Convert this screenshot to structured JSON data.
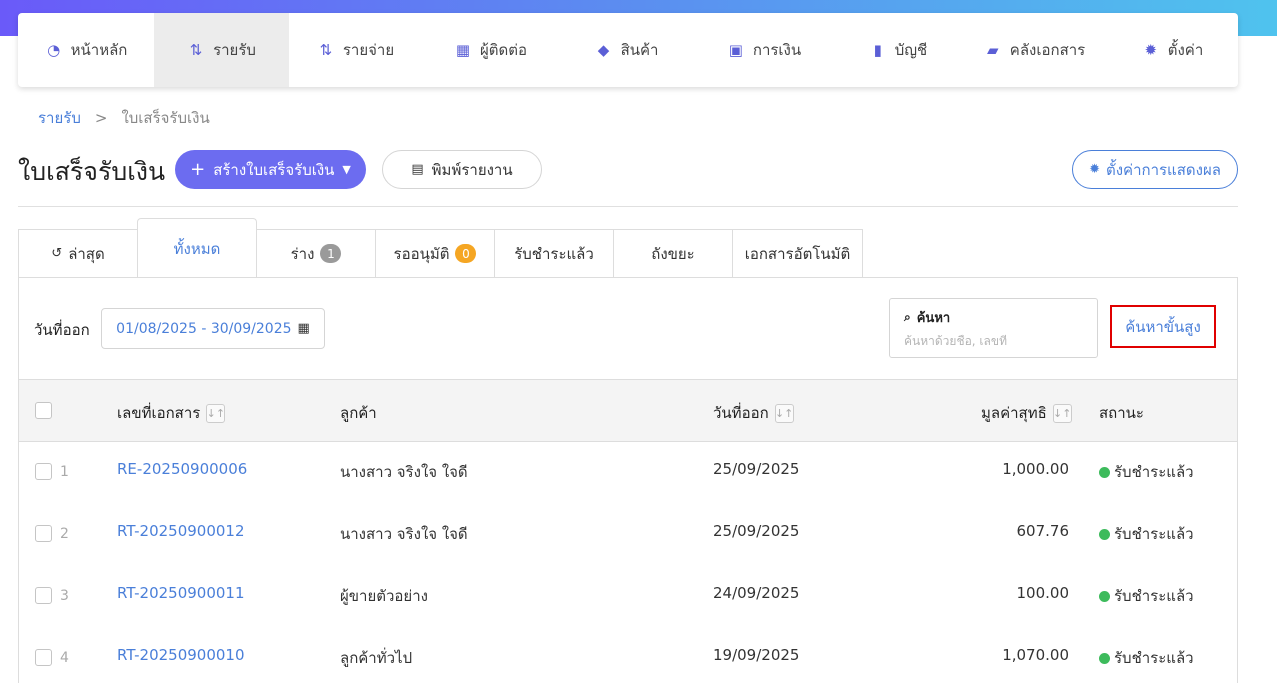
{
  "nav": {
    "items": [
      {
        "label": "หน้าหลัก",
        "icon": "dashboard-icon",
        "active": false
      },
      {
        "label": "รายรับ",
        "icon": "income-icon",
        "active": true
      },
      {
        "label": "รายจ่าย",
        "icon": "expense-icon",
        "active": false
      },
      {
        "label": "ผู้ติดต่อ",
        "icon": "contacts-icon",
        "active": false
      },
      {
        "label": "สินค้า",
        "icon": "box-icon",
        "active": false
      },
      {
        "label": "การเงิน",
        "icon": "money-icon",
        "active": false
      },
      {
        "label": "บัญชี",
        "icon": "ledger-icon",
        "active": false
      },
      {
        "label": "คลังเอกสาร",
        "icon": "folder-icon",
        "active": false
      },
      {
        "label": "ตั้งค่า",
        "icon": "gear-icon",
        "active": false
      }
    ]
  },
  "breadcrumb": {
    "parent": "รายรับ",
    "separator": ">",
    "current": "ใบเสร็จรับเงิน"
  },
  "page": {
    "title": "ใบเสร็จรับเงิน",
    "create_label": "สร้างใบเสร็จรับเงิน",
    "print_label": "พิมพ์รายงาน",
    "display_settings_label": "ตั้งค่าการแสดงผล"
  },
  "tabs": [
    {
      "label": "ล่าสุด",
      "badge": null
    },
    {
      "label": "ทั้งหมด",
      "badge": null,
      "active": true
    },
    {
      "label": "ร่าง",
      "badge": "1"
    },
    {
      "label": "รออนุมัติ",
      "badge": "0"
    },
    {
      "label": "รับชำระแล้ว",
      "badge": null
    },
    {
      "label": "ถังขยะ",
      "badge": null
    },
    {
      "label": "เอกสารอัตโนมัติ",
      "badge": null
    }
  ],
  "filter": {
    "date_label": "วันที่ออก",
    "date_range": "01/08/2025 - 30/09/2025",
    "search_title": "ค้นหา",
    "search_placeholder": "ค้นหาด้วยชื่อ, เลขที่",
    "advanced_search_label": "ค้นหาขั้นสูง"
  },
  "table": {
    "headers": {
      "doc_no": "เลขที่เอกสาร",
      "customer": "ลูกค้า",
      "issue_date": "วันที่ออก",
      "net_value": "มูลค่าสุทธิ",
      "status": "สถานะ"
    },
    "rows": [
      {
        "num": "1",
        "doc_no": "RE-20250900006",
        "customer": "นางสาว จริงใจ ใจดี",
        "issue_date": "25/09/2025",
        "net_value": "1,000.00",
        "status": "รับชำระแล้ว"
      },
      {
        "num": "2",
        "doc_no": "RT-20250900012",
        "customer": "นางสาว จริงใจ ใจดี",
        "issue_date": "25/09/2025",
        "net_value": "607.76",
        "status": "รับชำระแล้ว"
      },
      {
        "num": "3",
        "doc_no": "RT-20250900011",
        "customer": "ผู้ขายตัวอย่าง",
        "issue_date": "24/09/2025",
        "net_value": "100.00",
        "status": "รับชำระแล้ว"
      },
      {
        "num": "4",
        "doc_no": "RT-20250900010",
        "customer": "ลูกค้าทั่วไป",
        "issue_date": "19/09/2025",
        "net_value": "1,070.00",
        "status": "รับชำระแล้ว"
      }
    ]
  },
  "colors": {
    "accent": "#6c6cf0",
    "link": "#4a7fd9",
    "status_paid": "#3dbb5c",
    "highlight_border": "#e00000"
  }
}
